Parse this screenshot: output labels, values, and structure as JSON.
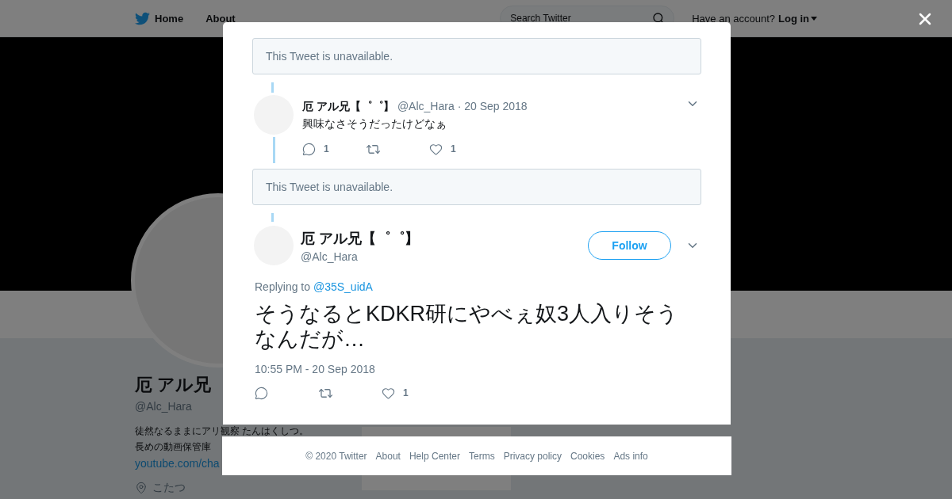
{
  "top_nav": {
    "home": "Home",
    "about": "About",
    "search": {
      "placeholder": "Search Twitter"
    },
    "account_prompt": "Have an account?",
    "login": "Log in"
  },
  "profile": {
    "name": "厄 アル兄",
    "handle": "@Alc_Hara",
    "bio_lines": [
      "徒然なるままにアリ観察 たんはくしつ。",
      "長めの動画保管庫"
    ],
    "link": "youtube.com/cha",
    "location": "こたつ"
  },
  "modal": {
    "thread": [
      {
        "kind": "unavailable",
        "text": "This Tweet is unavailable."
      },
      {
        "kind": "tweet",
        "name": "厄 アル兄【゜゜】",
        "handle": "@Alc_Hara",
        "date": "· 20 Sep 2018",
        "text": "興味なさそうだったけどなぁ",
        "actions": [
          {
            "kind": "reply",
            "count": "1"
          },
          {
            "kind": "retweet"
          },
          {
            "kind": "like",
            "count": "1"
          }
        ]
      },
      {
        "kind": "unavailable",
        "text": "This Tweet is unavailable."
      }
    ],
    "focus_tweet": {
      "name": "厄 アル兄【゜゜】",
      "handle": "@Alc_Hara",
      "follow": "Follow",
      "replying_label": "Replying to",
      "reply_to": "@35S_uidA",
      "text": "そうなるとKDKR研にやべぇ奴3人入りそうなんだが…",
      "timestamp": "10:55 PM - 20 Sep 2018",
      "actions": [
        {
          "kind": "reply"
        },
        {
          "kind": "retweet"
        },
        {
          "kind": "like",
          "count": "1"
        }
      ]
    }
  },
  "footer": {
    "copyright": "© 2020 Twitter",
    "links": [
      "About",
      "Help Center",
      "Terms",
      "Privacy policy",
      "Cookies",
      "Ads info"
    ]
  }
}
